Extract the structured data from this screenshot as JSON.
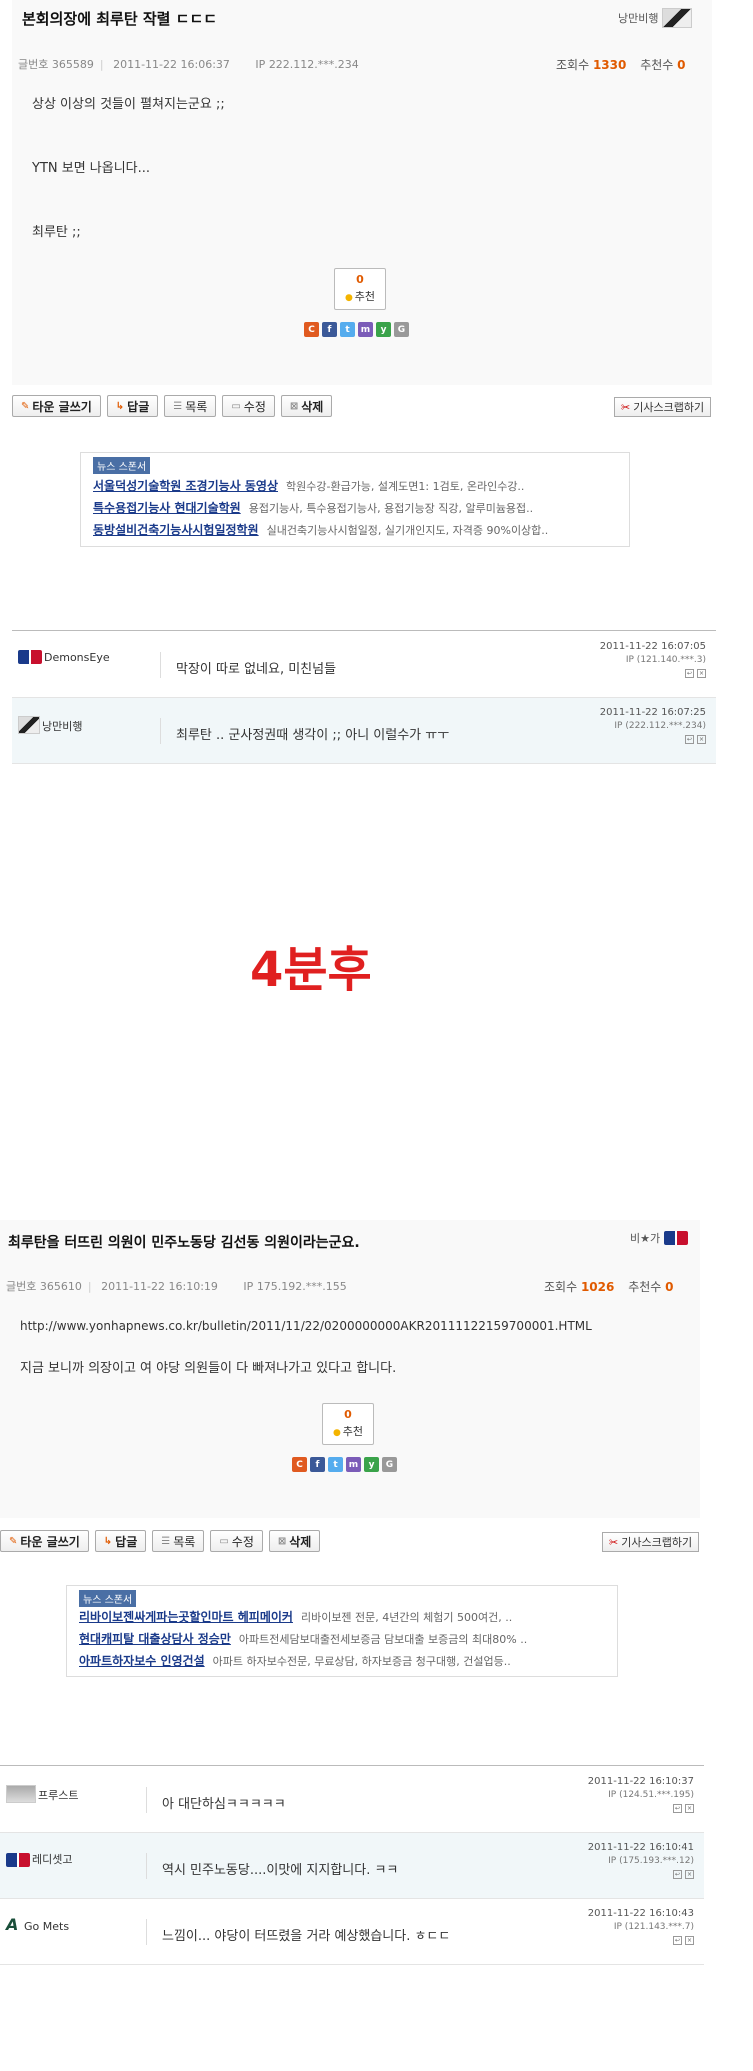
{
  "post1": {
    "title": "본회의장에 최루탄 작렬 ㄷㄷㄷ",
    "author": "낭만비행",
    "meta": {
      "num_label": "글번호",
      "num": "365589",
      "datetime": "2011-11-22 16:06:37",
      "ip_label": "IP",
      "ip": "222.112.***.234"
    },
    "views_label": "조회수",
    "views": "1330",
    "rec_label": "추천수",
    "rec": "0",
    "lines": [
      "상상 이상의 것들이 펼쳐지는군요 ;;",
      "YTN 보면 나옵니다...",
      "최루탄 ;;"
    ],
    "rec_box": {
      "count": "0",
      "label": "추천"
    }
  },
  "post2": {
    "title": "최루탄을 터뜨린 의원이 민주노동당 김선동 의원이라는군요.",
    "author": "비★가",
    "meta": {
      "num_label": "글번호",
      "num": "365610",
      "datetime": "2011-11-22 16:10:19",
      "ip_label": "IP",
      "ip": "175.192.***.155"
    },
    "views_label": "조회수",
    "views": "1026",
    "rec_label": "추천수",
    "rec": "0",
    "lines": [
      "http://www.yonhapnews.co.kr/bulletin/2011/11/22/0200000000AKR20111122159700001.HTML",
      "지금 보니까 의장이고 여 야당 의원들이 다 빠져나가고 있다고 합니다."
    ],
    "rec_box": {
      "count": "0",
      "label": "추천"
    }
  },
  "share_icons": [
    {
      "icon": "c-share-icon",
      "glyph": "C",
      "color": "#e05a20"
    },
    {
      "icon": "facebook-icon",
      "glyph": "f",
      "color": "#3b5998"
    },
    {
      "icon": "twitter-icon",
      "glyph": "t",
      "color": "#55acee"
    },
    {
      "icon": "me2day-icon",
      "glyph": "m",
      "color": "#7b5cb8"
    },
    {
      "icon": "yozm-icon",
      "glyph": "y",
      "color": "#3aa34a"
    },
    {
      "icon": "google-icon",
      "glyph": "G",
      "color": "#999999"
    }
  ],
  "buttons": {
    "write": "타운 글쓰기",
    "reply": "답글",
    "list": "목록",
    "edit": "수정",
    "delete": "삭제",
    "scrap": "기사스크랩하기"
  },
  "sponsor1": {
    "tag": "뉴스 스폰서",
    "rows": [
      {
        "name": "서울덕성기술학원 조경기능사 동영상",
        "desc": "학원수강-환급가능, 설계도면1: 1검토, 온라인수강.."
      },
      {
        "name": "특수용접기능사 현대기술학원",
        "desc": "용접기능사, 특수용접기능사, 용접기능장 직강, 알루미늄용접.."
      },
      {
        "name": "동방설비건축기능사시험일정학원",
        "desc": "실내건축기능사시험일정, 실기개인지도, 자격증 90%이상합.."
      }
    ]
  },
  "sponsor2": {
    "tag": "뉴스 스폰서",
    "rows": [
      {
        "name": "리바이보젠싸게파는곳할인마트 헤피메이커",
        "desc": "리바이보젠 전문, 4년간의 체험기 500여건, .."
      },
      {
        "name": "현대캐피탈 대출상담사 정승만",
        "desc": "아파트전세담보대출전세보증금 담보대출 보증금의 최대80% .."
      },
      {
        "name": "아파트하자보수 인영건설",
        "desc": "아파트 하자보수전문, 무료상담, 하자보증금 청구대행, 건설업등.."
      }
    ]
  },
  "comments1": [
    {
      "user": "DemonsEye",
      "avatar": "mlb",
      "text": "막장이 따로 없네요, 미친넘들",
      "date": "2011-11-22 16:07:05",
      "ip": "IP (121.140.***.3)"
    },
    {
      "user": "낭만비행",
      "avatar": "face",
      "text": "최루탄 .. 군사정권때 생각이 ;; 아니 이럴수가 ㅠㅜ",
      "date": "2011-11-22 16:07:25",
      "ip": "IP (222.112.***.234)"
    }
  ],
  "comments2": [
    {
      "user": "프루스트",
      "avatar": "photo",
      "text": "아 대단하심ㅋㅋㅋㅋㅋ",
      "date": "2011-11-22 16:10:37",
      "ip": "IP (124.51.***.195)"
    },
    {
      "user": "레디셋고",
      "avatar": "mlb",
      "text": "역시 민주노동당....이맛에 지지합니다. ㅋㅋ",
      "date": "2011-11-22 16:10:41",
      "ip": "IP (175.193.***.12)"
    },
    {
      "user": "Go Mets",
      "avatar": "gomets",
      "text": "느낌이... 야당이 터뜨렸을 거라 예상했습니다. ㅎㄷㄷ",
      "date": "2011-11-22 16:10:43",
      "ip": "IP (121.143.***.7)"
    }
  ],
  "overlay_text": "4분후"
}
